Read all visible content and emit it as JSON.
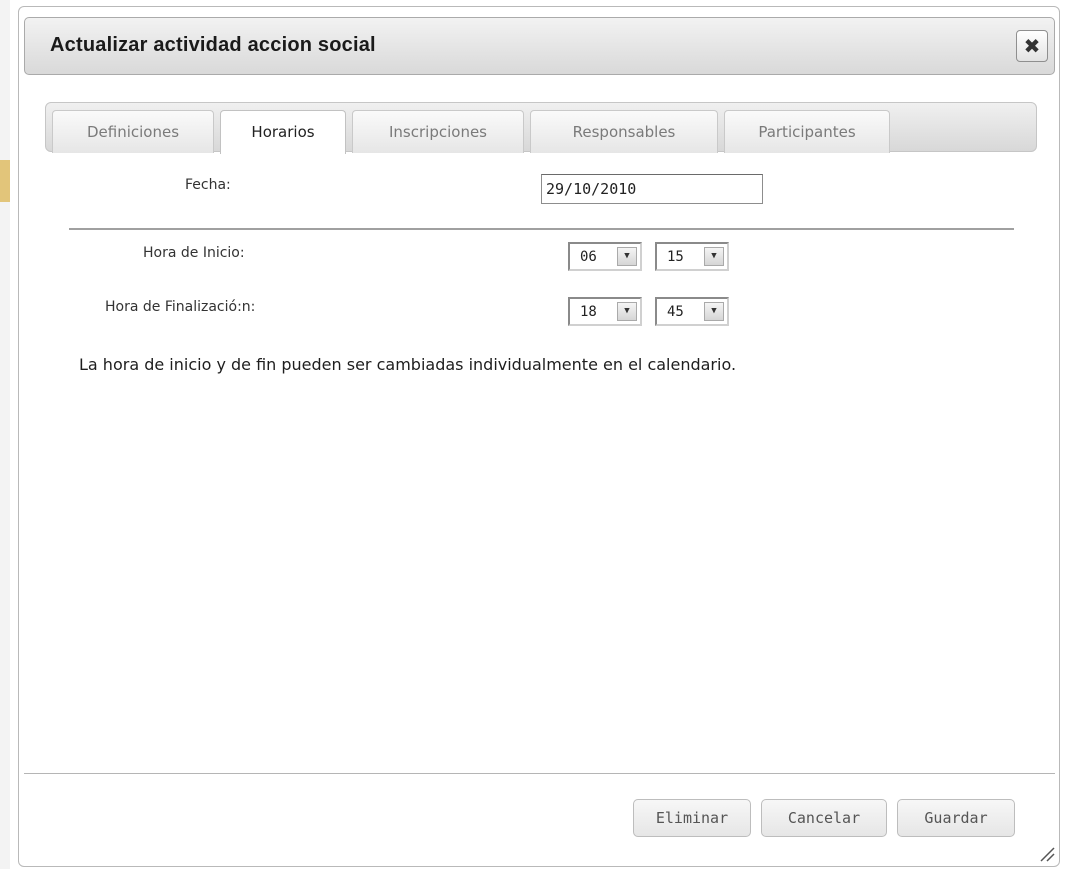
{
  "dialog": {
    "title": "Actualizar actividad accion social",
    "close_icon": "close-icon",
    "close_glyph": "✖"
  },
  "tabs": [
    {
      "label": "Definiciones",
      "active": false
    },
    {
      "label": "Horarios",
      "active": true
    },
    {
      "label": "Inscripciones",
      "active": false
    },
    {
      "label": "Responsables",
      "active": false
    },
    {
      "label": "Participantes",
      "active": false
    }
  ],
  "form": {
    "fecha_label": "Fecha:",
    "fecha_value": "29/10/2010",
    "inicio_label": "Hora de Inicio:",
    "inicio_hour": "06",
    "inicio_minute": "15",
    "fin_label": "Hora de Finalizació:n:",
    "fin_hour": "18",
    "fin_minute": "45",
    "dropdown_glyph": "▼",
    "note": "La hora de inicio y de fin pueden ser cambiadas individualmente en el calendario."
  },
  "buttons": {
    "eliminar": "Eliminar",
    "cancelar": "Cancelar",
    "guardar": "Guardar"
  }
}
